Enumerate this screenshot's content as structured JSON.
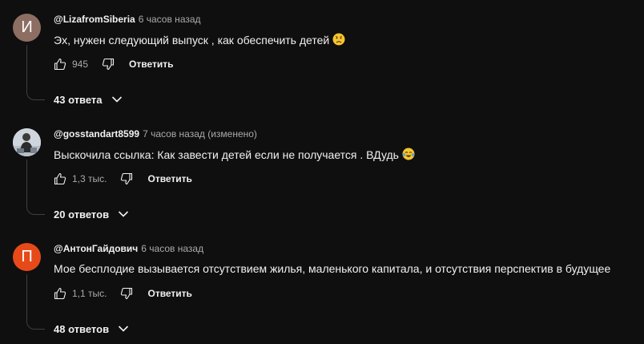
{
  "comments": [
    {
      "avatar_letter": "И",
      "avatar_color": "#8d6e63",
      "author": "@LizafromSiberia",
      "time": "6 часов назад",
      "text": "Эх, нужен  следующий выпуск  , как обеспечить детей",
      "emoji": "worried-face-icon",
      "likes": "945",
      "reply_label": "Ответить",
      "replies_label": "43 ответа"
    },
    {
      "avatar_letter": "",
      "author": "@gosstandart8599",
      "time": "7 часов назад (изменено)",
      "text": "Выскочила ссылка: Как завести детей если не получается . ВДудь",
      "emoji": "tears-of-joy-icon",
      "likes": "1,3 тыс.",
      "reply_label": "Ответить",
      "replies_label": "20 ответов"
    },
    {
      "avatar_letter": "П",
      "avatar_color": "#e64a19",
      "author": "@АнтонГайдович",
      "time": "6 часов назад",
      "text": "Мое бесплодие вызывается отсутствием жилья, маленького капитала, и отсутствия перспектив в будущее",
      "likes": "1,1 тыс.",
      "reply_label": "Ответить",
      "replies_label": "48 ответов"
    }
  ],
  "colors": {
    "background": "#0f0f0f",
    "text": "#f1f1f1",
    "secondary": "#aaaaaa",
    "emoji": "#f7c531"
  }
}
